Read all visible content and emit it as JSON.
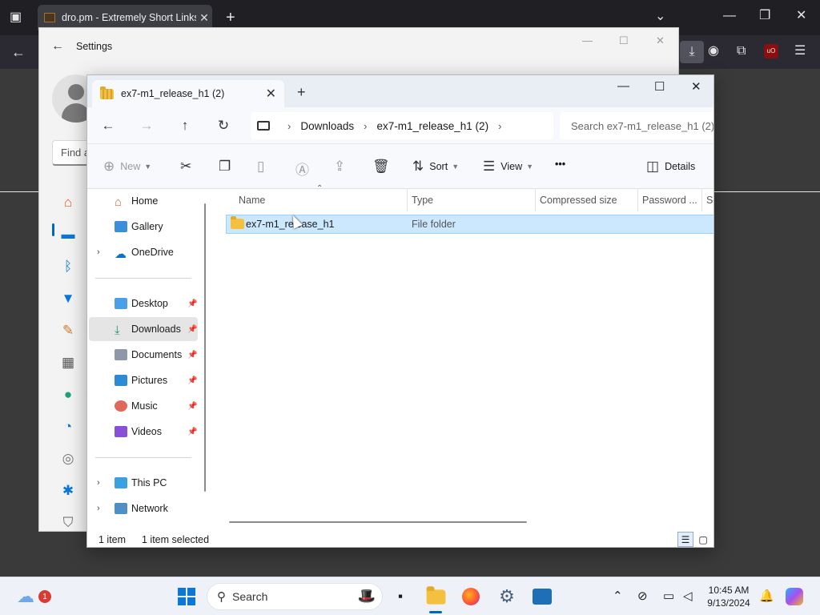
{
  "browser": {
    "tab_title": "dro.pm - Extremely Short Links",
    "tab_close": "✕",
    "new_tab": "+",
    "ext_badge": "uO"
  },
  "settings": {
    "title": "Settings",
    "find_placeholder": "Find a"
  },
  "explorer": {
    "tab_label": "ex7-m1_release_h1 (2)",
    "breadcrumb": [
      "Downloads",
      "ex7-m1_release_h1 (2)"
    ],
    "search_placeholder": "Search ex7-m1_release_h1 (2)",
    "commands": {
      "new": "New",
      "sort": "Sort",
      "view": "View",
      "more": "•••",
      "details": "Details"
    },
    "nav": {
      "home": "Home",
      "gallery": "Gallery",
      "onedrive": "OneDrive",
      "desktop": "Desktop",
      "downloads": "Downloads",
      "documents": "Documents",
      "pictures": "Pictures",
      "music": "Music",
      "videos": "Videos",
      "this_pc": "This PC",
      "network": "Network"
    },
    "columns": [
      "Name",
      "Type",
      "Compressed size",
      "Password ...",
      "Si"
    ],
    "rows": [
      {
        "name": "ex7-m1_release_h1",
        "type": "File folder"
      }
    ],
    "status": {
      "count": "1 item",
      "selected": "1 item selected"
    }
  },
  "taskbar": {
    "search_label": "Search",
    "time": "10:45 AM",
    "date": "9/13/2024",
    "notification_count": "1"
  }
}
